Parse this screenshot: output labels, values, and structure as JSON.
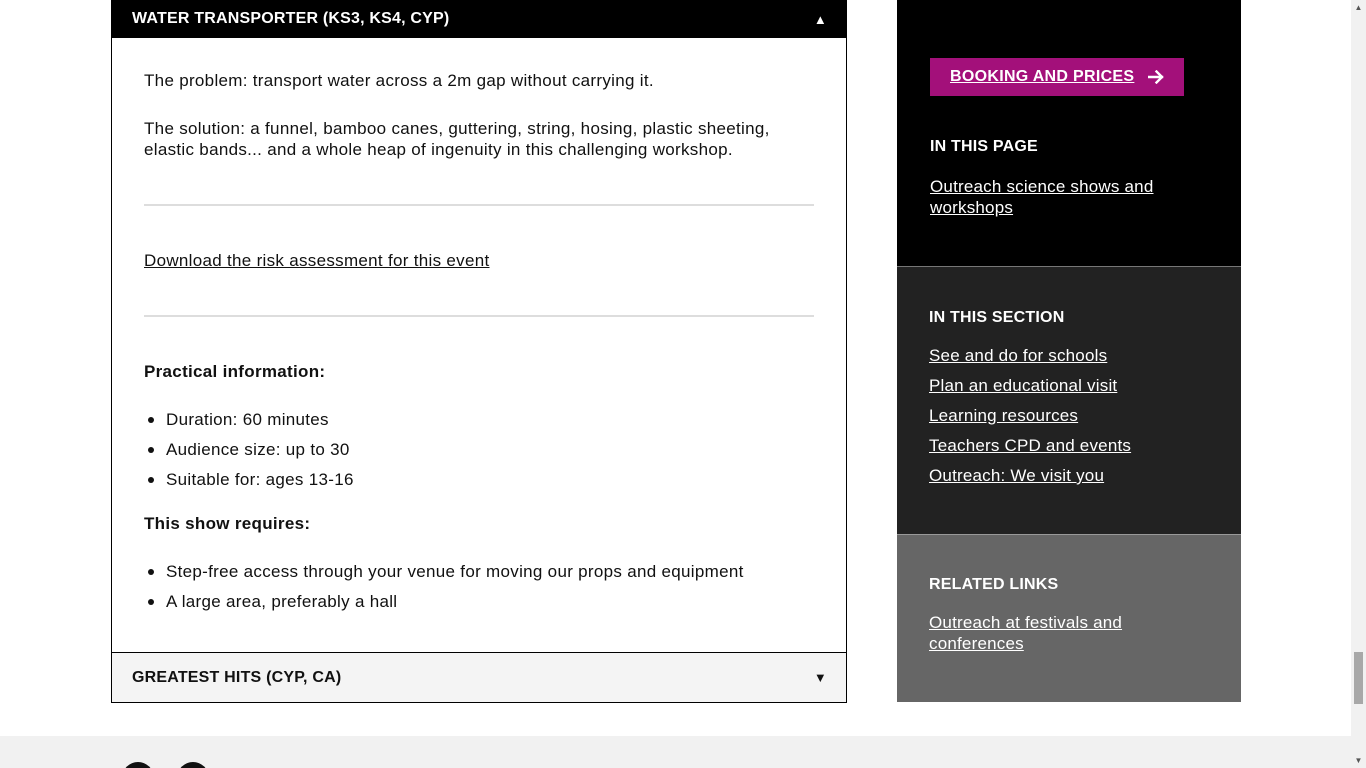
{
  "accordion": {
    "open_title": "WATER TRANSPORTER (KS3, KS4, CYP)",
    "open_arrow": "▲",
    "problem": "The problem: transport water across a 2m gap without carrying it.",
    "solution": "The solution: a funnel, bamboo canes, guttering, string, hosing, plastic sheeting, elastic bands... and a whole heap of ingenuity in this challenging workshop.",
    "risk_link": "Download the risk assessment for this event",
    "practical_heading": "Practical information:",
    "practical_items": [
      "Duration: 60 minutes",
      "Audience size: up to 30",
      "Suitable for: ages 13-16"
    ],
    "requires_heading": "This show requires:",
    "requires_items": [
      "Step-free access through your venue for moving our props and equipment",
      "A large area, preferably a hall"
    ],
    "closed_title": "GREATEST HITS (CYP, CA)",
    "closed_arrow": "▼"
  },
  "sidebar": {
    "booking_label": "BOOKING AND PRICES",
    "booking_icon": "arrow-right-icon",
    "in_this_page_heading": "IN THIS PAGE",
    "in_this_page_links": [
      "Outreach science shows and workshops"
    ],
    "in_this_section_heading": "IN THIS SECTION",
    "in_this_section_links": [
      "See and do for schools",
      "Plan an educational visit",
      "Learning resources",
      "Teachers CPD and events",
      "Outreach: We visit you"
    ],
    "related_heading": "RELATED LINKS",
    "related_links": [
      "Outreach at festivals and conferences"
    ],
    "colors": {
      "booking": "#a3107a",
      "page_panel": "#000000",
      "section_panel": "#222222",
      "related_panel": "#666666"
    }
  }
}
